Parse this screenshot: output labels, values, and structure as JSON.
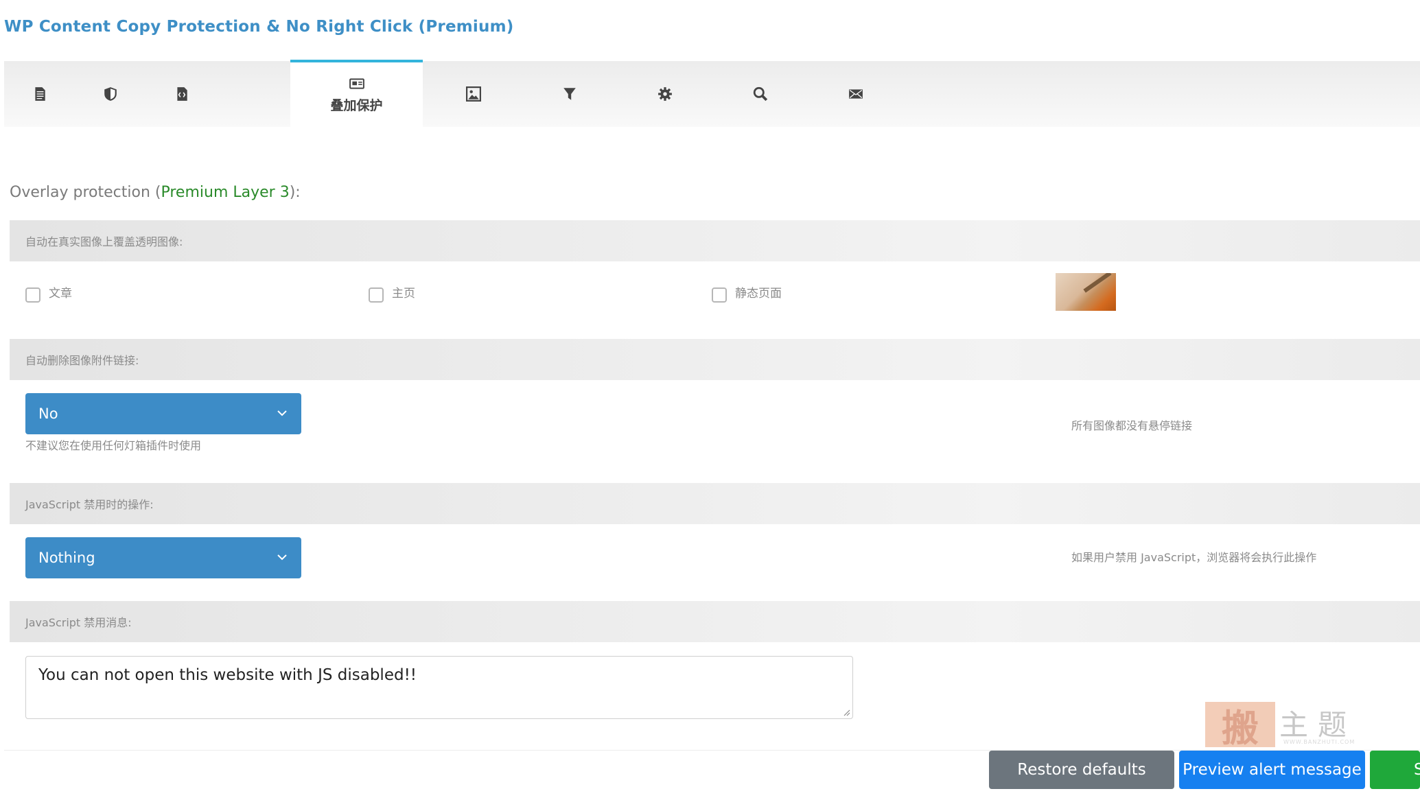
{
  "page": {
    "title": "WP Content Copy Protection & No Right Click (Premium)"
  },
  "tabs": [
    {
      "icon": "document-icon",
      "label": ""
    },
    {
      "icon": "shield-icon",
      "label": ""
    },
    {
      "icon": "code-file-icon",
      "label": ""
    },
    {
      "icon": "overlay-image-icon",
      "label": "叠加保护",
      "active": true
    },
    {
      "icon": "picture-icon",
      "label": ""
    },
    {
      "icon": "filter-icon",
      "label": ""
    },
    {
      "icon": "gear-icon",
      "label": ""
    },
    {
      "icon": "search-icon",
      "label": ""
    },
    {
      "icon": "envelope-icon",
      "label": ""
    }
  ],
  "section": {
    "title_prefix": "Overlay protection (",
    "title_premium": "Premium Layer 3",
    "title_suffix": "):"
  },
  "overlay": {
    "heading": "自动在真实图像上覆盖透明图像:",
    "checkboxes": [
      {
        "label": "文章",
        "checked": false
      },
      {
        "label": "主页",
        "checked": false
      },
      {
        "label": "静态页面",
        "checked": false
      }
    ]
  },
  "attachment_links": {
    "heading": "自动删除图像附件链接:",
    "selected": "No",
    "note": "不建议您在使用任何灯箱插件时使用",
    "hint": "所有图像都没有悬停链接"
  },
  "js_disabled_action": {
    "heading": "JavaScript 禁用时的操作:",
    "selected": "Nothing",
    "hint": "如果用户禁用 JavaScript，浏览器将会执行此操作"
  },
  "js_disabled_message": {
    "heading": "JavaScript 禁用消息:",
    "value": "You can not open this website with JS disabled!!"
  },
  "watermark": {
    "glyph": "搬",
    "text": "主题",
    "small": "WWW.BANZHUTI.COM"
  },
  "buttons": {
    "restore": "Restore defaults",
    "preview": "Preview alert message",
    "save": "S"
  },
  "colors": {
    "title": "#3e8fc6",
    "active_tab_border": "#33b4dc",
    "select_bg": "#3d8cc7",
    "premium_green": "#2a8a2a",
    "restore_btn": "#6c757d",
    "preview_btn": "#1680f0",
    "save_btn": "#1fa83a"
  }
}
